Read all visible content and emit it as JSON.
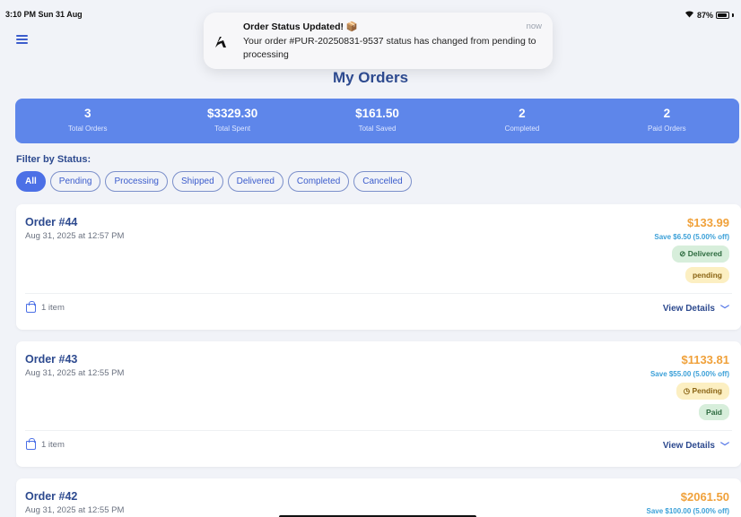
{
  "status_bar": {
    "time": "3:10 PM  Sun 31 Aug",
    "battery": "87%"
  },
  "notification": {
    "title": "Order Status Updated! 📦",
    "time": "now",
    "body": "Your order #PUR-20250831-9537 status has changed from pending to processing"
  },
  "page": {
    "title": "My Orders"
  },
  "stats": [
    {
      "value": "3",
      "label": "Total Orders"
    },
    {
      "value": "$3329.30",
      "label": "Total Spent"
    },
    {
      "value": "$161.50",
      "label": "Total Saved"
    },
    {
      "value": "2",
      "label": "Completed"
    },
    {
      "value": "2",
      "label": "Paid Orders"
    }
  ],
  "filter": {
    "label": "Filter by Status:",
    "options": [
      "All",
      "Pending",
      "Processing",
      "Shipped",
      "Delivered",
      "Completed",
      "Cancelled"
    ],
    "selected": "All"
  },
  "orders": [
    {
      "title": "Order #44",
      "date": "Aug 31, 2025 at 12:57 PM",
      "price": "$133.99",
      "save": "Save $6.50 (5.00% off)",
      "status_badge": "Delivered",
      "payment_badge": "pending",
      "items": "1 item",
      "view_label": "View Details"
    },
    {
      "title": "Order #43",
      "date": "Aug 31, 2025 at 12:55 PM",
      "price": "$1133.81",
      "save": "Save $55.00 (5.00% off)",
      "status_badge": "Pending",
      "payment_badge": "Paid",
      "items": "1 item",
      "view_label": "View Details"
    },
    {
      "title": "Order #42",
      "date": "Aug 31, 2025 at 12:55 PM",
      "price": "$2061.50",
      "save": "Save $100.00 (5.00% off)"
    }
  ],
  "colors": {
    "accent": "#4c70e6",
    "stats_bg": "#5e86ea",
    "price": "#f0a13a",
    "title": "#2d4a8f"
  }
}
